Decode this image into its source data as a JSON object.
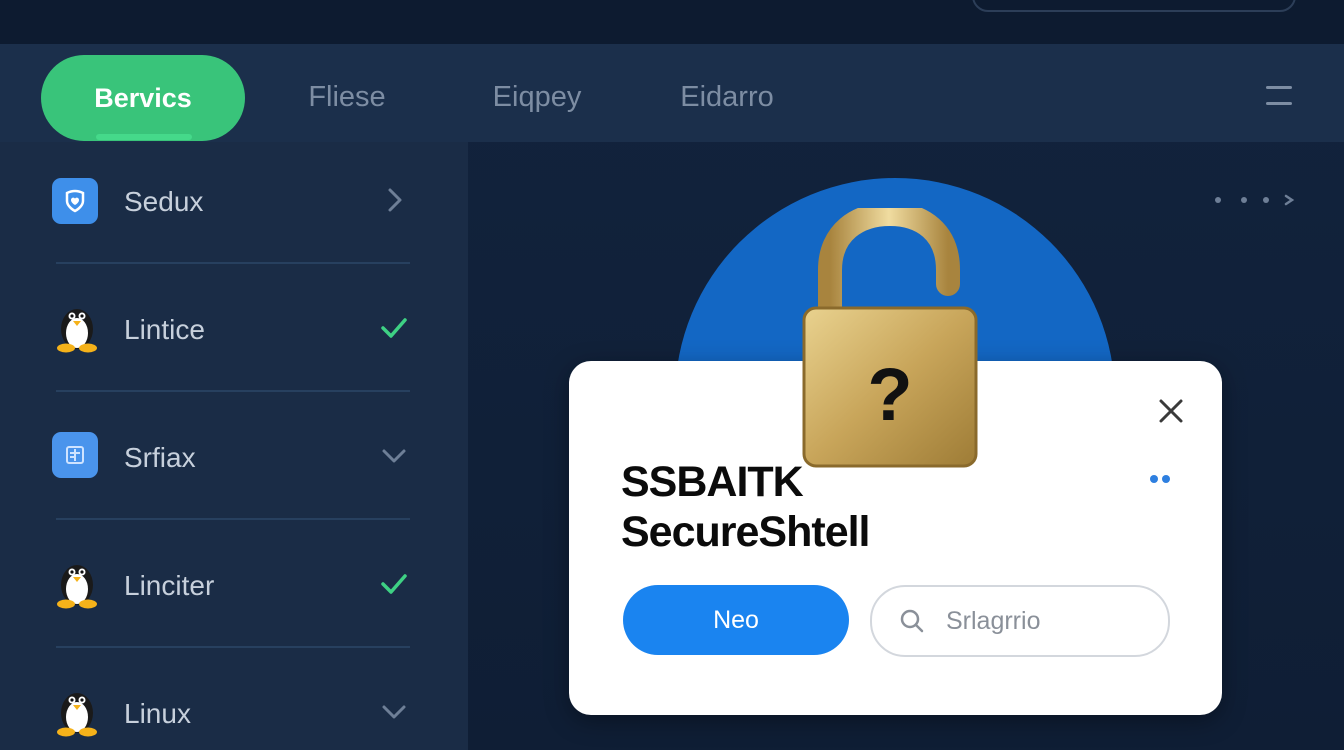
{
  "header": {
    "logo_icon": "logo-icon",
    "search_icon": "search-box"
  },
  "tabs": [
    {
      "label": "Bervics",
      "active": true
    },
    {
      "label": "Fliese",
      "active": false
    },
    {
      "label": "Eiqpey",
      "active": false
    },
    {
      "label": "Eidarro",
      "active": false
    }
  ],
  "tab_menu_icon": "hamburger-icon",
  "sidebar": {
    "items": [
      {
        "label": "Sedux",
        "icon": "shield-icon",
        "status_icon": "chevron-right-icon"
      },
      {
        "label": "Lintice",
        "icon": "penguin-icon",
        "status_icon": "check-icon"
      },
      {
        "label": "Srfiax",
        "icon": "app-icon",
        "status_icon": "chevron-down-icon"
      },
      {
        "label": "Linciter",
        "icon": "penguin-icon",
        "status_icon": "check-icon"
      },
      {
        "label": "Linux",
        "icon": "penguin-icon",
        "status_icon": "chevron-down-icon"
      }
    ]
  },
  "main": {
    "more_icon": "more-dots-icon",
    "lock_icon": "padlock-question-icon"
  },
  "dialog": {
    "title_line1": "SSBAITK",
    "title_line2": "SecureShtell",
    "primary_button": "Neo",
    "search_placeholder": "Srlagrrio",
    "close_icon": "close-icon"
  },
  "colors": {
    "background": "#10203a",
    "tab_bar": "#1b2f4b",
    "sidebar": "#1a2c46",
    "accent_green": "#39c47a",
    "accent_blue": "#1a84f0",
    "circle_blue": "#1367c4",
    "check_green": "#3ed184"
  }
}
